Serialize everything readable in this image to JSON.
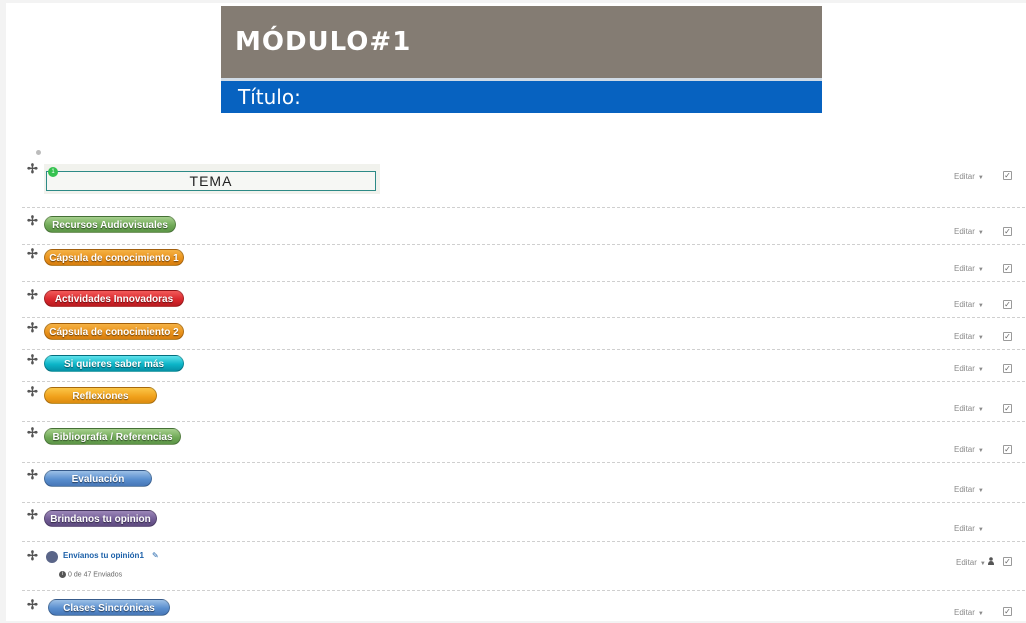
{
  "banner": {
    "title": "MÓDULO#1",
    "subtitle": "Título:",
    "colors": {
      "top": "#847c73",
      "bottom": "#0762c0"
    }
  },
  "tema": {
    "label": "TEMA",
    "badge": "1"
  },
  "common": {
    "edit_label": "Editar",
    "caret": "▼",
    "check": "✓"
  },
  "sections": [
    {
      "label": "Recursos Audiovisuales",
      "color": "green"
    },
    {
      "label": "Cápsula de conocimiento 1",
      "color": "orange"
    },
    {
      "label": "Actividades Innovadoras",
      "color": "red"
    },
    {
      "label": "Cápsula de conocimiento 2",
      "color": "orange"
    },
    {
      "label": "Si quieres saber más",
      "color": "cyan"
    },
    {
      "label": "Reflexiones",
      "color": "amber"
    },
    {
      "label": "Bibliografía / Referencias",
      "color": "green"
    },
    {
      "label": "Evaluación",
      "color": "blue"
    },
    {
      "label": "Brindanos tu opinion",
      "color": "purple"
    }
  ],
  "feedback": {
    "name": "Envíanos tu opinión1",
    "submissions": "0 de 47 Enviados",
    "icon": "feedback-icon"
  },
  "last_section": {
    "label": "Clases Sincrónicas",
    "color": "blue"
  }
}
